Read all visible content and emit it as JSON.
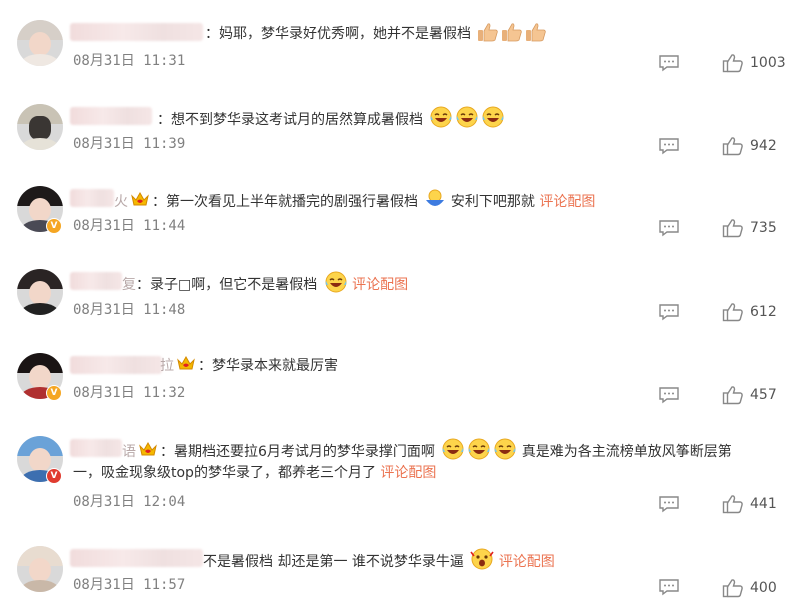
{
  "comments": [
    {
      "time": "08月31日 11:31",
      "text": "妈耶，梦华录好优秀啊，她并不是暑假档",
      "emojis": [
        "thumbs-up",
        "thumbs-up",
        "thumbs-up"
      ],
      "likes": "1003"
    },
    {
      "time": "08月31日 11:39",
      "text": "想不到梦华录这考试月的居然算成暑假档",
      "emojis": [
        "laugh-cry",
        "laugh-cry",
        "laugh-cry"
      ],
      "likes": "942"
    },
    {
      "time": "08月31日 11:44",
      "text": "第一次看见上半年就播完的剧强行暑假档",
      "text_after": "安利下吧那就",
      "link": "评论配图",
      "likes": "735"
    },
    {
      "time": "08月31日 11:48",
      "text": "录子□啊，但它不是暑假档",
      "link": "评论配图",
      "likes": "612"
    },
    {
      "time": "08月31日 11:32",
      "text": "梦华录本来就最厉害",
      "likes": "457"
    },
    {
      "time": "08月31日 12:04",
      "text": "暑期档还要拉6月考试月的梦华录撑门面啊",
      "text_after": "真是难为各主流榜单放风筝断层第",
      "text_line2": "一，吸金现象级top的梦华录了，都养老三个月了",
      "link": "评论配图",
      "name_tail": "语",
      "likes": "441"
    },
    {
      "time": "08月31日 11:57",
      "text": "不是暑假档 却还是第一 谁不说梦华录牛逼",
      "link": "评论配图",
      "likes": "400"
    }
  ],
  "name_tails": {
    "c3": "火",
    "c4": "复",
    "c5": "拉"
  },
  "separator": "：",
  "colors": {
    "link": "#eb7350",
    "time": "#808080",
    "text": "#333333"
  }
}
